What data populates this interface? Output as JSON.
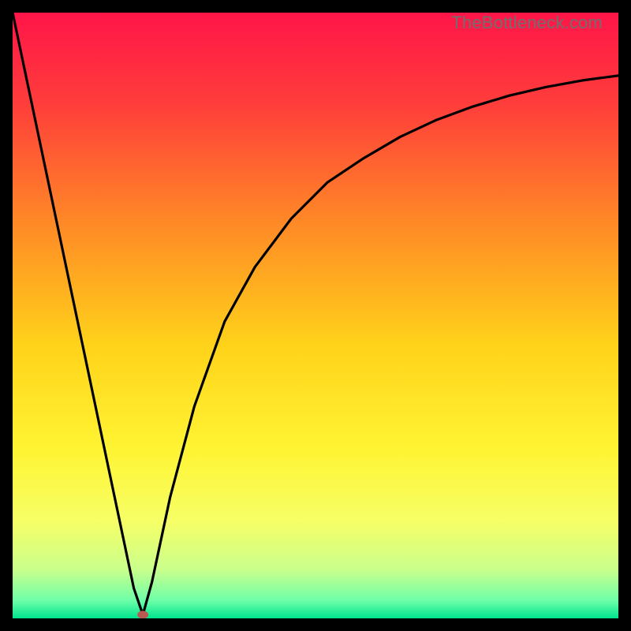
{
  "watermark": "TheBottleneck.com",
  "chart_data": {
    "type": "line",
    "title": "",
    "xlabel": "",
    "ylabel": "",
    "xlim": [
      0,
      100
    ],
    "ylim": [
      0,
      100
    ],
    "grid": false,
    "legend": false,
    "background_gradient": {
      "stops": [
        {
          "offset": 0.0,
          "color": "#ff1548"
        },
        {
          "offset": 0.15,
          "color": "#ff3d3b"
        },
        {
          "offset": 0.35,
          "color": "#ff8a26"
        },
        {
          "offset": 0.55,
          "color": "#ffd31a"
        },
        {
          "offset": 0.72,
          "color": "#fff433"
        },
        {
          "offset": 0.84,
          "color": "#f6ff66"
        },
        {
          "offset": 0.92,
          "color": "#c9ff8c"
        },
        {
          "offset": 0.97,
          "color": "#6fffa8"
        },
        {
          "offset": 1.0,
          "color": "#00e58f"
        }
      ]
    },
    "marker": {
      "x": 21.5,
      "y": 0.6,
      "color": "#b85a52",
      "rx": 7,
      "ry": 5
    },
    "series": [
      {
        "name": "curve",
        "color": "#000000",
        "x": [
          0,
          4,
          8,
          12,
          16,
          20,
          21.5,
          23,
          26,
          30,
          35,
          40,
          46,
          52,
          58,
          64,
          70,
          76,
          82,
          88,
          94,
          100
        ],
        "y": [
          100,
          81,
          62,
          43,
          24,
          5,
          0.6,
          6,
          20,
          35,
          49,
          58,
          66,
          72,
          76,
          79.5,
          82.3,
          84.5,
          86.3,
          87.7,
          88.8,
          89.6
        ]
      }
    ]
  }
}
